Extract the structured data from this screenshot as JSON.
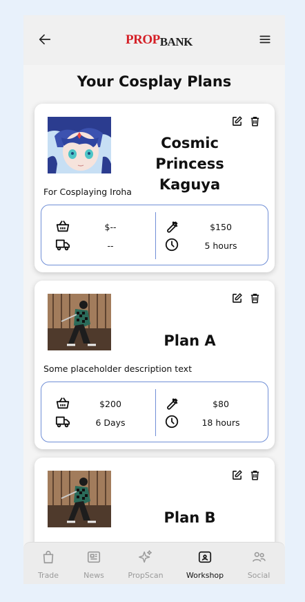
{
  "header": {
    "logo_part1": "PROP",
    "logo_part2": "BANK"
  },
  "page_title": "Your Cosplay Plans",
  "plans": [
    {
      "name": "Cosmic Princess Kaguya",
      "description": "For Cosplaying Iroha",
      "materials_cost": "$--",
      "shipping_time": "--",
      "tools_cost": "$150",
      "labor_time": "5 hours"
    },
    {
      "name": "Plan A",
      "description": "Some placeholder description text",
      "materials_cost": "$200",
      "shipping_time": "6 Days",
      "tools_cost": "$80",
      "labor_time": "18 hours"
    },
    {
      "name": "Plan B"
    }
  ],
  "tabbar": {
    "items": [
      {
        "label": "Trade",
        "icon": "shopping-bag-icon"
      },
      {
        "label": "News",
        "icon": "newspaper-icon"
      },
      {
        "label": "PropScan",
        "icon": "sparkle-icon"
      },
      {
        "label": "Workshop",
        "icon": "workshop-icon",
        "active": true
      },
      {
        "label": "Social",
        "icon": "people-icon"
      }
    ]
  },
  "colors": {
    "accent_border": "#6f8ed6",
    "logo_red": "#d41f26",
    "page_bg": "#e8f1fb"
  }
}
